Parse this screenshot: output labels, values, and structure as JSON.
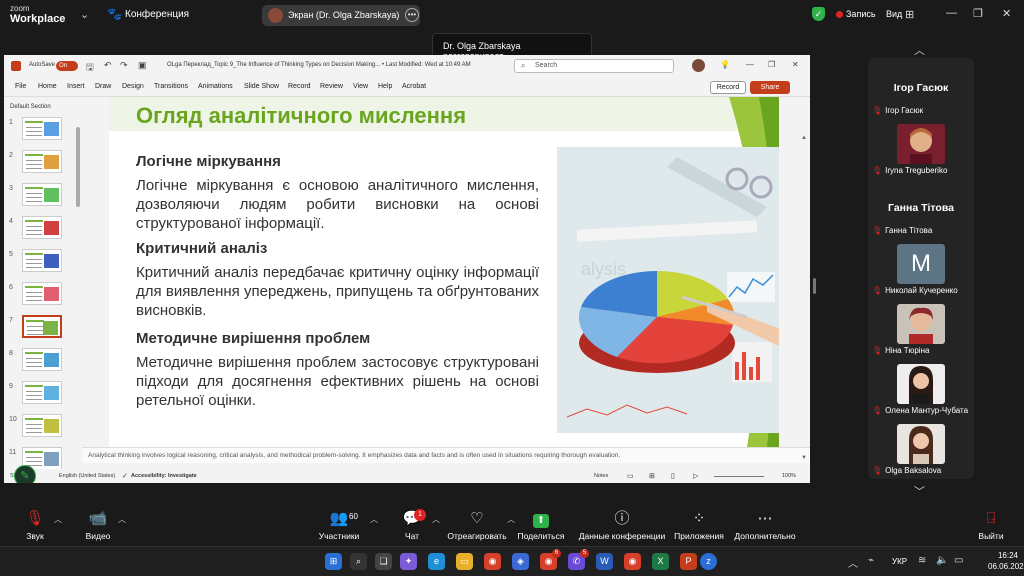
{
  "topbar": {
    "logo_line1": "zoom",
    "logo_line2": "Workplace",
    "conference_label": "Конференция",
    "screen_share_label": "Экран (Dr. Olga Zbarskaya)",
    "record_label": "Запись",
    "view_label": "Вид"
  },
  "tooltip": "Dr. Olga Zbarskaya разговаривает...",
  "ppt": {
    "autosave_label": "AutoSave",
    "autosave_state": "On",
    "doc_title": "OLga Переклад_Topic 9_The Influence of Thinking Types on Decision Making...  •  Last Modified: Wed at 10:49 AM",
    "search_placeholder": "Search",
    "menu": [
      "File",
      "Home",
      "Insert",
      "Draw",
      "Design",
      "Transitions",
      "Animations",
      "Slide Show",
      "Record",
      "Review",
      "View",
      "Help",
      "Acrobat"
    ],
    "record_btn": "Record",
    "share_btn": "Share",
    "section_label": "Default Section",
    "thumb_numbers": [
      "1",
      "2",
      "3",
      "4",
      "5",
      "6",
      "7",
      "8",
      "9",
      "10",
      "11"
    ],
    "slide": {
      "title": "Огляд аналітичного мислення",
      "h1": "Логічне міркування",
      "p1": "Логічне міркування є основою аналітичного мислення, дозволяючи людям робити висновки на основі структурованої інформації.",
      "h2": "Критичний аналіз",
      "p2": "Критичний аналіз передбачає критичну оцінку інформації для виявлення упереджень, припущень та обґрунтованих висновків.",
      "h3": "Методичне вирішення проблем",
      "p3": "Методичне вирішення проблем застосовує структуровані підходи для досягнення ефективних рішень на основі ретельної оцінки.",
      "img_text": "alysis"
    },
    "notes": "Analytical thinking involves logical reasoning, critical analysis, and methodical problem-solving. It emphasizes data and facts and is often used in situations requiring thorough evaluation.",
    "status": {
      "slide_label": "Sli",
      "language": "English (United States)",
      "accessibility": "Accessibility: Investigate",
      "notes_label": "Notes",
      "zoom": "100%"
    }
  },
  "participants": {
    "p1_big": "Ігор Гасюк",
    "p1_name": "Ігор Гасюк",
    "p2_name": "Iryna Treguberiko",
    "p3_big": "Ганна Тітова",
    "p3_name": "Ганна Тітова",
    "p4_initial": "M",
    "p4_name": "Николай Кучеренко",
    "p5_name": "Ніна Тюріна",
    "p6_name": "Олена Мантур-Чубата",
    "p7_name": "Olga Baksalova"
  },
  "zoombar": {
    "audio": "Звук",
    "video": "Видео",
    "participants": "Участники",
    "participants_count": "60",
    "chat": "Чат",
    "chat_badge": "1",
    "react": "Отреагировать",
    "share": "Поделиться",
    "info": "Данные конференции",
    "apps": "Приложения",
    "more": "Дополнительно",
    "leave": "Выйти"
  },
  "taskbar": {
    "lang": "УКР",
    "time": "16:24",
    "date": "06.06.2025",
    "badges": [
      "6",
      "5"
    ]
  },
  "colors": {
    "accent_green": "#6aa51f",
    "ppt_red": "#c43e1c",
    "zoom_green": "#2fb24a"
  }
}
